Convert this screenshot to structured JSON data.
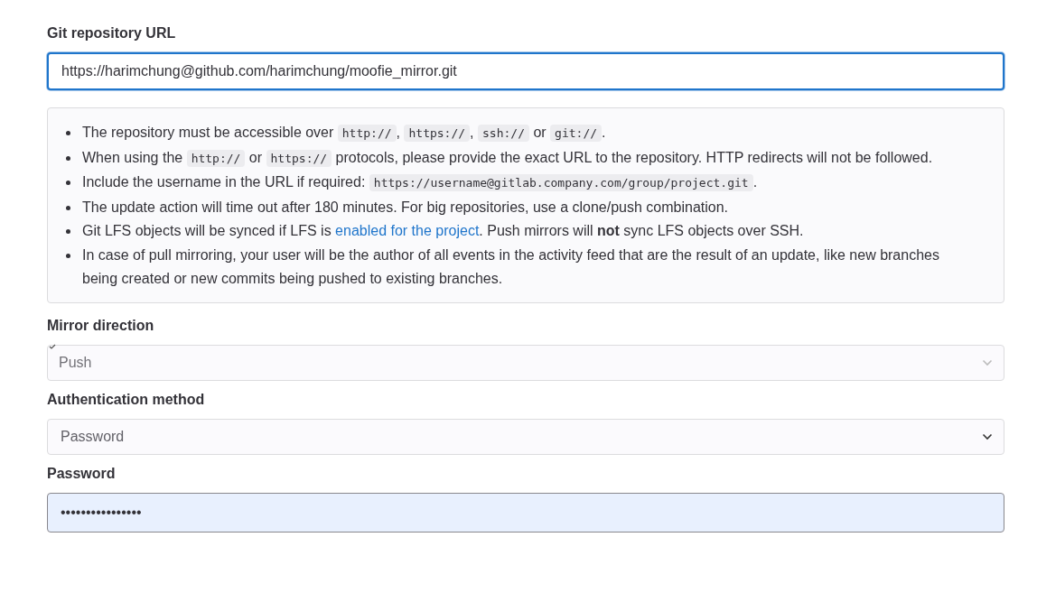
{
  "repository_url": {
    "label": "Git repository URL",
    "value": "https://harimchung@github.com/harimchung/moofie_mirror.git",
    "focused": true
  },
  "help": [
    [
      {
        "kind": "text",
        "text": "The repository must be accessible over "
      },
      {
        "kind": "code",
        "text": "http://"
      },
      {
        "kind": "text",
        "text": ", "
      },
      {
        "kind": "code",
        "text": "https://"
      },
      {
        "kind": "text",
        "text": ", "
      },
      {
        "kind": "code",
        "text": "ssh://"
      },
      {
        "kind": "text",
        "text": " or "
      },
      {
        "kind": "code",
        "text": "git://"
      },
      {
        "kind": "text",
        "text": "."
      }
    ],
    [
      {
        "kind": "text",
        "text": "When using the "
      },
      {
        "kind": "code",
        "text": "http://"
      },
      {
        "kind": "text",
        "text": " or "
      },
      {
        "kind": "code",
        "text": "https://"
      },
      {
        "kind": "text",
        "text": " protocols, please provide the exact URL to the repository. HTTP redirects will not be followed."
      }
    ],
    [
      {
        "kind": "text",
        "text": "Include the username in the URL if required: "
      },
      {
        "kind": "code",
        "text": "https://username@gitlab.company.com/group/project.git"
      },
      {
        "kind": "text",
        "text": "."
      }
    ],
    [
      {
        "kind": "text",
        "text": "The update action will time out after 180 minutes. For big repositories, use a clone/push combination."
      }
    ],
    [
      {
        "kind": "text",
        "text": "Git LFS objects will be synced if LFS is "
      },
      {
        "kind": "link",
        "text": "enabled for the project"
      },
      {
        "kind": "text",
        "text": ". Push mirrors will **not** sync LFS objects over SSH."
      }
    ],
    [
      {
        "kind": "text",
        "text": "In case of pull mirroring, your user will be the author of all events in the activity feed that are the result of an update, like new branches being created or new commits being pushed to existing branches."
      }
    ]
  ],
  "mirror_direction": {
    "label": "Mirror direction",
    "value": "Push",
    "disabled": true
  },
  "authentication_method": {
    "label": "Authentication method",
    "value": "Password",
    "disabled": false
  },
  "password": {
    "label": "Password",
    "value": "••••••••••••••••",
    "autofilled": true
  }
}
